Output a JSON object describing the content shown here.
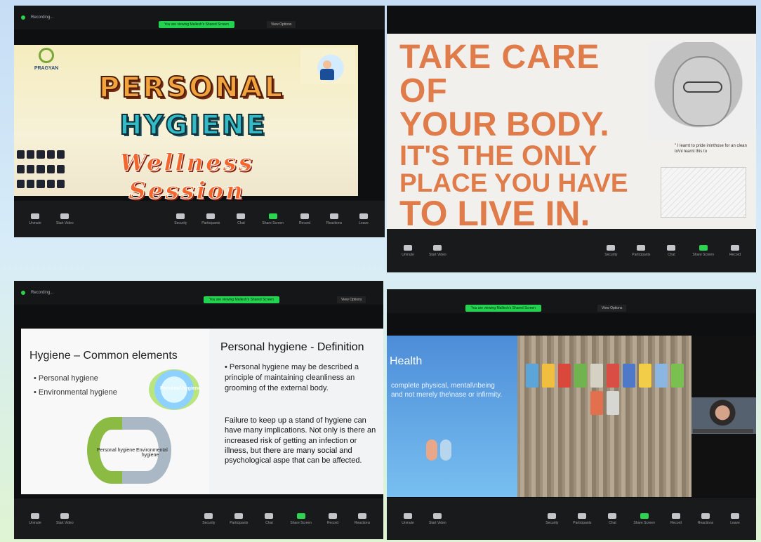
{
  "panels": {
    "p1": {
      "logo_text": "PRAGYAN",
      "title_lines": [
        "PERSONAL",
        "HYGIENE",
        "Wellness Session"
      ],
      "top_left": "Recording...",
      "share_text": "You are viewing Mallesh's Shared Screen",
      "view_options": "View Options",
      "toolbar_left": [
        "Unmute",
        "Start Video"
      ],
      "toolbar_right": [
        "Security",
        "Participants",
        "Chat",
        "Share Screen",
        "Record",
        "Reactions",
        "Leave"
      ]
    },
    "p2": {
      "quote_lines": [
        "TAKE CARE OF",
        "YOUR BODY.",
        "IT'S THE ONLY",
        "PLACE YOU HAVE",
        "TO LIVE IN."
      ],
      "small_quote": "\" I learnt to pride in\\nthose for an clean to\\nI learnt this to",
      "toolbar_left": [
        "Unmute",
        "Start Video"
      ],
      "toolbar_right": [
        "Security",
        "Participants",
        "Chat",
        "Share Screen",
        "Record"
      ]
    },
    "p3": {
      "top_left": "Recording...",
      "share_text": "You are viewing Mallesh's Shared Screen",
      "view_options": "View Options",
      "left_title": "Hygiene – Common elements",
      "left_bullets": [
        "Personal hygiene",
        "Environmental hygiene"
      ],
      "badge_text": "Personal hygiene",
      "cycle_labels": [
        "Personal hygiene",
        "Environmental hygiene"
      ],
      "right_title": "Personal hygiene - Definition",
      "right_p1": "• Personal hygiene may be described a principle of maintaining cleanliness an grooming of the external body.",
      "right_p2": "Failure to keep up a stand of hygiene can have many implications. Not only is there an increased risk of getting an infection or illness, but there are many social and psychological aspe that can be affected.",
      "toolbar_left": [
        "Unmute",
        "Start Video"
      ],
      "toolbar_right": [
        "Security",
        "Participants",
        "Chat",
        "Share Screen",
        "Record",
        "Reactions"
      ]
    },
    "p4": {
      "share_text": "You are viewing Mallesh's Shared Screen",
      "view_options": "View Options",
      "left_title": "Health",
      "left_text": "complete physical, mental\\nbeing and not merely the\\nase or infirmity.",
      "toolbar_left": [
        "Unmute",
        "Start Video"
      ],
      "toolbar_right": [
        "Security",
        "Participants",
        "Chat",
        "Share Screen",
        "Record",
        "Reactions",
        "Leave"
      ]
    }
  },
  "colors": {
    "green": "#23d24f",
    "orange_text": "#e07b4a"
  },
  "icons": {
    "record": "record-icon",
    "mic": "microphone-icon",
    "camera": "camera-icon",
    "share": "share-screen-icon"
  }
}
